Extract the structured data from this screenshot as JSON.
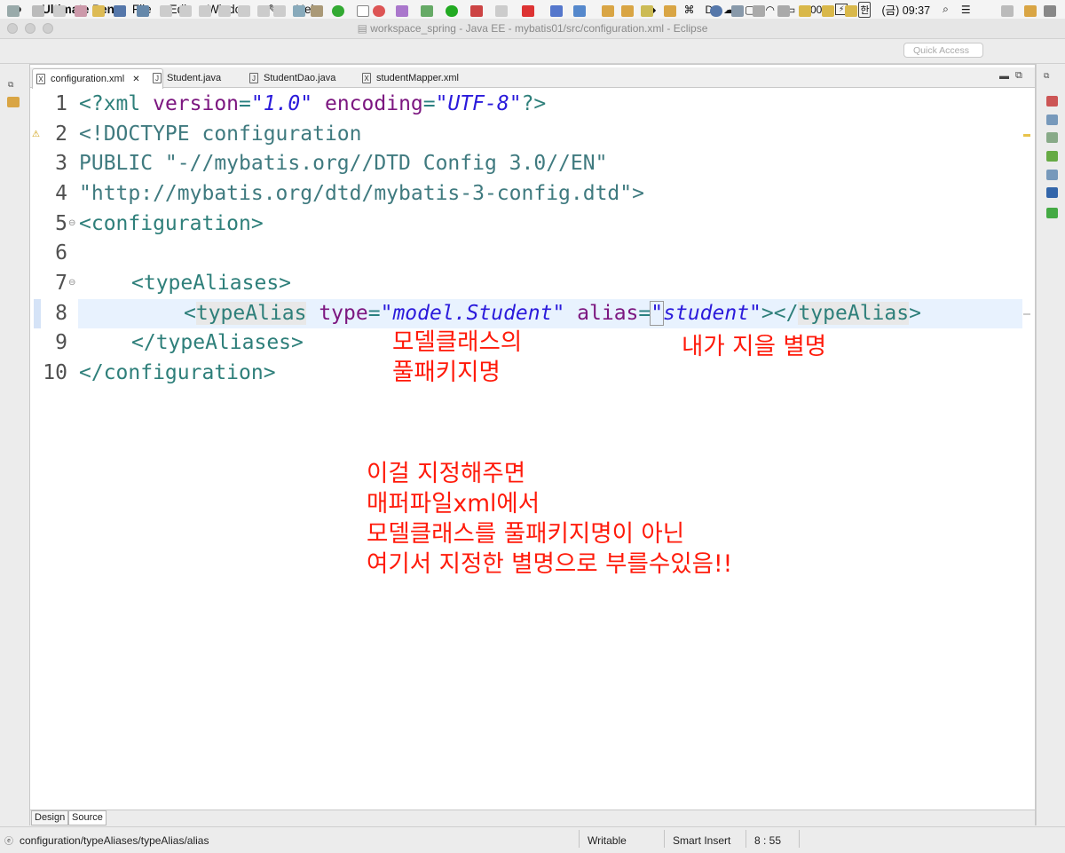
{
  "menubar": {
    "app": "Ultimate Pen",
    "items": [
      "File",
      "Edit",
      "Window",
      "Help"
    ],
    "battery": "100%",
    "ime": "한",
    "clock": "(금) 09:37"
  },
  "window": {
    "title": "workspace_spring - Java EE - mybatis01/src/configuration.xml - Eclipse"
  },
  "toolbar": {
    "quick_access": "Quick Access"
  },
  "tabs": [
    {
      "label": "configuration.xml",
      "icon": "xml-file-icon",
      "active": true
    },
    {
      "label": "Student.java",
      "icon": "java-file-icon",
      "active": false
    },
    {
      "label": "StudentDao.java",
      "icon": "java-file-icon",
      "active": false
    },
    {
      "label": "studentMapper.xml",
      "icon": "xml-file-icon",
      "active": false
    }
  ],
  "code": {
    "line_numbers": [
      "1",
      "2",
      "3",
      "4",
      "5",
      "6",
      "7",
      "8",
      "9",
      "10"
    ],
    "l1": {
      "a": "<?xml ",
      "b": "version",
      "c": "=",
      "d": "\"1.0\"",
      "e": " encoding",
      "f": "=",
      "g": "\"UTF-8\"",
      "h": "?>"
    },
    "l2": "<!DOCTYPE configuration",
    "l3": "PUBLIC \"-//mybatis.org//DTD Config 3.0//EN\"",
    "l4": "\"http://mybatis.org/dtd/mybatis-3-config.dtd\">",
    "l5": "<configuration>",
    "l7": "<typeAliases>",
    "l8": {
      "a": "<",
      "b": "typeAlias",
      "c": " type",
      "d": "=",
      "e": "\"model.Student\"",
      "f": " alias",
      "g": "=",
      "h": "\"",
      "i": "student\"",
      "j": "></",
      "k": "typeAlias",
      "l": ">"
    },
    "l9": "</typeAliases>",
    "l10": "</configuration>"
  },
  "annotations": {
    "a1": "모델클래스의\n풀패키지명",
    "a2": "내가 지을 별명",
    "a3": "이걸 지정해주면\n매퍼파일xml에서\n모델클래스를 풀패키지명이 아닌\n여기서 지정한 별명으로 부를수있음!!"
  },
  "editor_tabs": {
    "design": "Design",
    "source": "Source"
  },
  "status": {
    "path": "configuration/typeAliases/typeAlias/alias",
    "mode": "Writable",
    "insert": "Smart Insert",
    "position": "8 : 55"
  }
}
